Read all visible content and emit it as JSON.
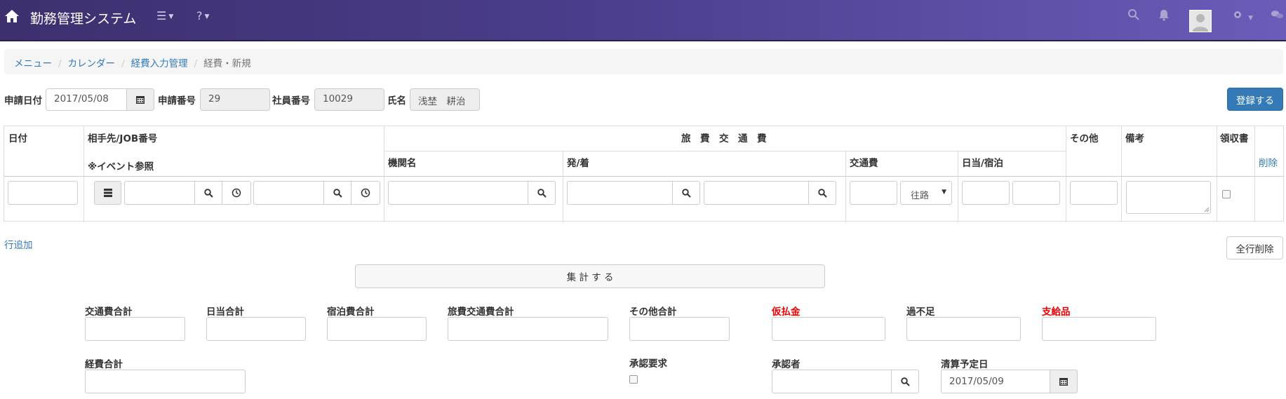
{
  "app": {
    "title": "勤務管理システム",
    "bar_color": "#4a3d8b"
  },
  "breadcrumb": {
    "items": [
      "メニュー",
      "カレンダー",
      "経費入力管理"
    ],
    "current": "経費・新規"
  },
  "header": {
    "apply_date_label": "申請日付",
    "apply_date_value": "2017/05/08",
    "apply_no_label": "申請番号",
    "apply_no_value": "29",
    "employee_no_label": "社員番号",
    "employee_no_value": "10029",
    "name_label": "氏名",
    "name_value": "浅埜　耕治",
    "register_button": "登録する"
  },
  "table": {
    "col_date": "日付",
    "col_partner": "相手先/JOB番号",
    "col_event_ref": "※イベント参照",
    "group_travel": "旅　費　交　通　費",
    "col_org": "機関名",
    "col_depart_arrive": "発/着",
    "col_transport": "交通費",
    "col_daily_lodging": "日当/宿泊",
    "col_other": "その他",
    "col_remarks": "備考",
    "col_receipt": "領収書",
    "trip_option": "往路",
    "delete_link": "削除"
  },
  "actions": {
    "add_row": "行追加",
    "delete_all": "全行削除",
    "calculate": "集 計 す る"
  },
  "totals": {
    "transport_total": "交通費合計",
    "daily_total": "日当合計",
    "lodging_total": "宿泊費合計",
    "travel_total": "旅費交通費合計",
    "other_total": "その他合計",
    "advance": "仮払金",
    "shortage": "過不足",
    "supply": "支給品",
    "expense_total": "経費合計",
    "approval_request": "承認要求",
    "approver": "承認者",
    "settlement_date_label": "清算予定日",
    "settlement_date_value": "2017/05/09"
  }
}
